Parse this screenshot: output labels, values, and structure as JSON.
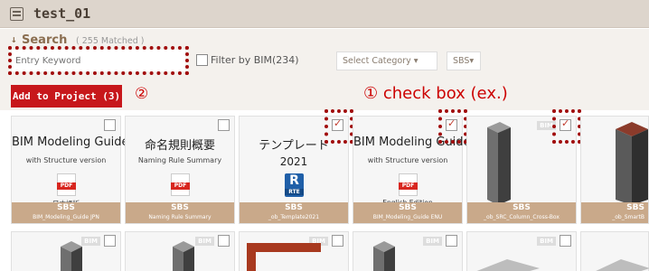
{
  "window": {
    "title": "test_01",
    "icon": "list-icon"
  },
  "search": {
    "label": "Search",
    "count": "( 255 Matched )",
    "placeholder": "Entry Keyword",
    "sort_icon": "AZ"
  },
  "filters": {
    "bim_label": "Filter by BIM(234)",
    "category": "Select Category ▾",
    "org": "SBS▾"
  },
  "add_button": "Add to Project (3)",
  "annotations": {
    "step1": "① check box (ex.)",
    "step2": "②"
  },
  "cards": [
    {
      "title": "BIM Modeling Guide",
      "subtitle": "with Structure version",
      "note": "日本語版",
      "icon": "pdf-icon",
      "icon_tag": "PDF",
      "org": "SBS",
      "name": "BIM_Modeling_Guide JPN",
      "checked": false
    },
    {
      "title": "命名規則概要",
      "subtitle": "Naming Rule Summary",
      "note": "",
      "icon": "pdf-icon",
      "icon_tag": "PDF",
      "org": "SBS",
      "name": "Naming Rule Summary",
      "checked": false
    },
    {
      "title": "テンプレート",
      "subtitle": "2021",
      "note": "",
      "icon": "rte-icon",
      "icon_tag": "RTE",
      "org": "SBS",
      "name": "_ob_Template2021",
      "checked": true
    },
    {
      "title": "BIM Modeling Guide",
      "subtitle": "with Structure version",
      "note": "English Edition",
      "icon": "pdf-icon",
      "icon_tag": "PDF",
      "org": "SBS",
      "name": "BIM_Modeling_Guide ENU",
      "checked": true
    },
    {
      "badge": "BIM",
      "icon": "column-3d-icon",
      "org": "SBS",
      "name": "_ob_SRC_Column_Cross-Box",
      "checked": true
    },
    {
      "icon": "column-3d-icon",
      "org": "SBS",
      "name": "_ob_SmartB",
      "checked": false
    }
  ],
  "row2_badges": [
    "BIM",
    "BIM",
    "BIM",
    "BIM",
    "BIM",
    ""
  ],
  "colors": {
    "accent_red": "#c7171b",
    "card_footer": "#c9a98a",
    "title_bar": "#ddd5cc",
    "annotation": "#cc0000"
  }
}
